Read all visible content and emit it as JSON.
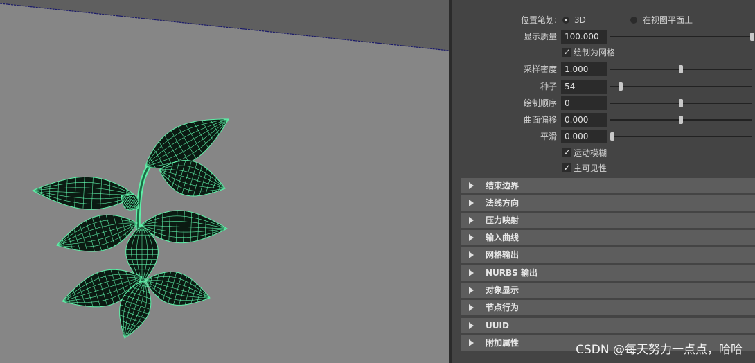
{
  "panel": {
    "brush_label": "位置笔划:",
    "radio_3d": "3D",
    "radio_plane": "在视图平面上",
    "display_quality_label": "显示质量",
    "display_quality_value": "100.000",
    "draw_as_mesh_label": "绘制为网格",
    "sample_density_label": "采样密度",
    "sample_density_value": "1.000",
    "seed_label": "种子",
    "seed_value": "54",
    "draw_order_label": "绘制顺序",
    "draw_order_value": "0",
    "surface_offset_label": "曲面偏移",
    "surface_offset_value": "0.000",
    "smoothing_label": "平滑",
    "smoothing_value": "0.000",
    "motion_blur_label": "运动模糊",
    "primary_visibility_label": "主可见性",
    "check_mark": "✓",
    "sliders": {
      "display_quality": 1.0,
      "sample_density": 0.5,
      "seed": 0.08,
      "draw_order": 0.5,
      "surface_offset": 0.5,
      "smoothing": 0.02
    },
    "sections": [
      "结束边界",
      "法线方向",
      "压力映射",
      "输入曲线",
      "网格输出",
      "NURBS 输出",
      "对象显示",
      "节点行为",
      "UUID",
      "附加属性"
    ]
  },
  "watermark": "CSDN @每天努力一点点，哈哈",
  "colors": {
    "viewport_bg": "#868686",
    "mesh_line": "#5ef0a8",
    "leaf_fill": "#0b1a12",
    "panel_bg": "#444444",
    "section_bg": "#5d5d5d",
    "horizon_line": "#1a1a6a"
  }
}
